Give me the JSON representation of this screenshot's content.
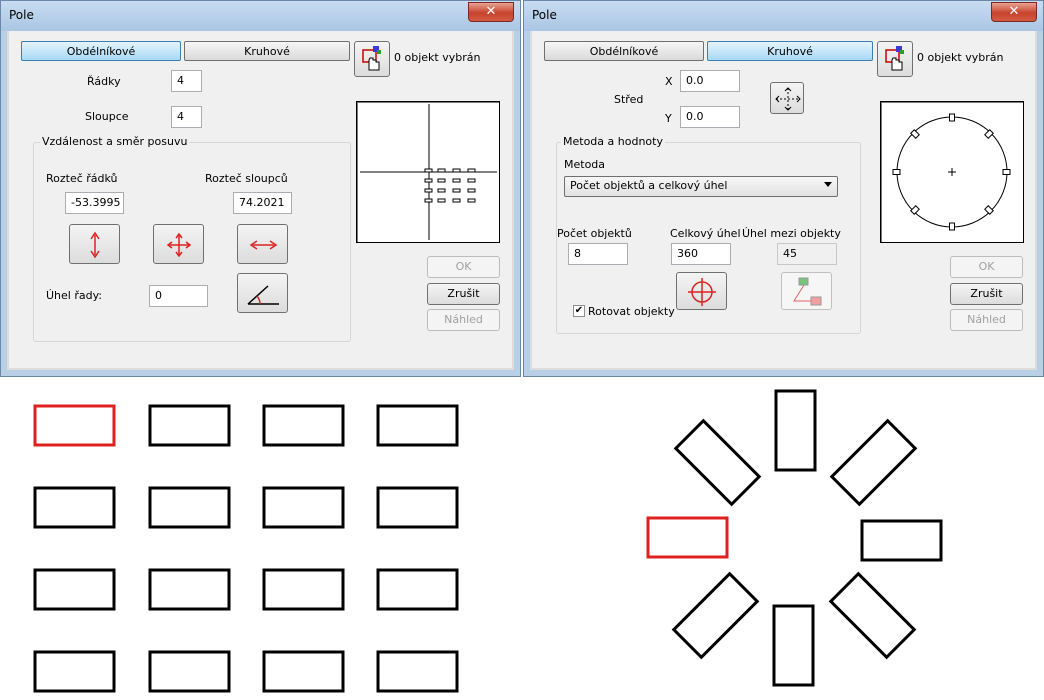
{
  "left_dialog": {
    "title": "Pole",
    "tabs": [
      "Obdélníkové",
      "Kruhové"
    ],
    "active_tab": "Obdélníkové",
    "selection_status": "0 objekt vybrán",
    "rows_label": "Řádky",
    "rows_value": "4",
    "columns_label": "Sloupce",
    "columns_value": "4",
    "offset_group_title": "Vzdálenost a směr posuvu",
    "row_spacing_label": "Rozteč řádků",
    "row_spacing_value": "-53.3995",
    "column_spacing_label": "Rozteč sloupců",
    "column_spacing_value": "74.2021",
    "row_angle_label": "Úhel řady:",
    "row_angle_value": "0",
    "ok_label": "OK",
    "cancel_label": "Zrušit",
    "preview_label": "Náhled"
  },
  "right_dialog": {
    "title": "Pole",
    "tabs": [
      "Obdélníkové",
      "Kruhové"
    ],
    "active_tab": "Kruhové",
    "selection_status": "0 objekt vybrán",
    "center_label": "Střed",
    "x_label": "X",
    "x_value": "0.0",
    "y_label": "Y",
    "y_value": "0.0",
    "method_group_title": "Metoda a hodnoty",
    "method_label": "Metoda",
    "method_selected": "Počet objektů a celkový úhel",
    "count_label": "Počet objektů",
    "count_value": "8",
    "total_angle_label": "Celkový úhel",
    "total_angle_value": "360",
    "angle_between_label": "Úhel mezi objekty",
    "angle_between_value": "45",
    "rotate_label": "Rotovat objekty",
    "rotate_checked": true,
    "ok_label": "OK",
    "cancel_label": "Zrušit",
    "preview_label": "Náhled"
  },
  "canvas": {
    "rect_grid": {
      "rows": 4,
      "columns": 4,
      "highlighted": "top-left",
      "highlight_color": "#e0201e"
    },
    "polar_array": {
      "count": 8,
      "total_angle": 360,
      "highlighted": "left",
      "highlight_color": "#e0201e"
    }
  },
  "colors": {
    "title_bar": "#b9cfe6",
    "active_tab": "#a7d9f5",
    "close_button": "#c7432d",
    "highlight": "#e0201e"
  }
}
